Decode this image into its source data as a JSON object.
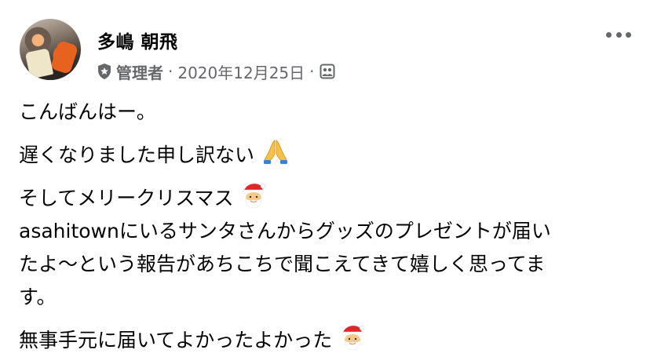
{
  "post": {
    "author_name": "多嶋 朝飛",
    "role": "管理者",
    "separator": "·",
    "date": "2020年12月25日",
    "icons": {
      "role": "shield-star-icon",
      "privacy": "group-photo-icon",
      "more": "more-horizontal-icon"
    },
    "lines": [
      {
        "text": "こんばんはー。",
        "emoji": ""
      },
      {
        "text": "遅くなりました申し訳ない",
        "emoji": "folded-hands-emoji"
      },
      {
        "text": "そしてメリークリスマス",
        "emoji": "santa-emoji"
      },
      {
        "text": "asahitownにいるサンタさんからグッズのプレゼントが届い",
        "emoji": ""
      },
      {
        "text": "たよ〜という報告があちこちで聞こえてきて嬉しく思ってま",
        "emoji": ""
      },
      {
        "text": "す。",
        "emoji": ""
      },
      {
        "text": "無事手元に届いてよかったよかった",
        "emoji": "santa-emoji"
      }
    ]
  },
  "colors": {
    "text": "#050505",
    "secondary": "#65676b",
    "background": "#ffffff"
  }
}
